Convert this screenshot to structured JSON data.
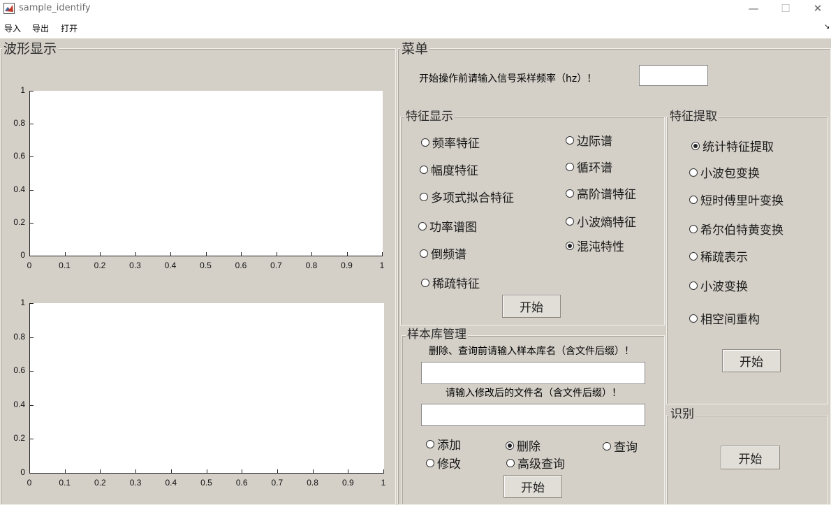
{
  "window": {
    "title": "sample_identify",
    "minimize": "—",
    "maximize": "☐",
    "close": "✕"
  },
  "menu": {
    "import": "导入",
    "export": "导出",
    "open": "打开",
    "arrow": "↘"
  },
  "panels": {
    "waveform_title": "波形显示",
    "menu_title": "菜单",
    "feature_display_title": "特征显示",
    "feature_extract_title": "特征提取",
    "library_title": "样本库管理",
    "identify_title": "识别"
  },
  "sample_rate": {
    "prompt": "开始操作前请输入信号采样频率（hz）！",
    "value": ""
  },
  "feature_display": {
    "options": [
      "频率特征",
      "幅度特征",
      "多项式拟合特征",
      "功率谱图",
      "倒频谱",
      "稀疏特征",
      "边际谱",
      "循环谱",
      "高阶谱特征",
      "小波熵特征",
      "混沌特性"
    ],
    "selected": "混沌特性",
    "start": "开始"
  },
  "feature_extract": {
    "options": [
      "统计特征提取",
      "小波包变换",
      "短时傅里叶变换",
      "希尔伯特黄变换",
      "稀疏表示",
      "小波变换",
      "相空间重构"
    ],
    "selected": "统计特征提取",
    "start": "开始"
  },
  "library": {
    "name_prompt": "删除、查询前请输入样本库名（含文件后缀）！",
    "name_value": "",
    "rename_prompt": "请输入修改后的文件名（含文件后缀）！",
    "rename_value": "",
    "options": [
      "添加",
      "删除",
      "查询",
      "修改",
      "高级查询"
    ],
    "selected": "删除",
    "start": "开始"
  },
  "identify": {
    "start": "开始"
  },
  "chart_data": [
    {
      "type": "line",
      "title": "",
      "xlabel": "",
      "ylabel": "",
      "xlim": [
        0,
        1
      ],
      "ylim": [
        0,
        1
      ],
      "xticks": [
        "0",
        "0.1",
        "0.2",
        "0.3",
        "0.4",
        "0.5",
        "0.6",
        "0.7",
        "0.8",
        "0.9",
        "1"
      ],
      "yticks": [
        "0",
        "0.2",
        "0.4",
        "0.6",
        "0.8",
        "1"
      ],
      "series": []
    },
    {
      "type": "line",
      "title": "",
      "xlabel": "",
      "ylabel": "",
      "xlim": [
        0,
        1
      ],
      "ylim": [
        0,
        1
      ],
      "xticks": [
        "0",
        "0.1",
        "0.2",
        "0.3",
        "0.4",
        "0.5",
        "0.6",
        "0.7",
        "0.8",
        "0.9",
        "1"
      ],
      "yticks": [
        "0",
        "0.2",
        "0.4",
        "0.6",
        "0.8",
        "1"
      ],
      "series": []
    }
  ]
}
